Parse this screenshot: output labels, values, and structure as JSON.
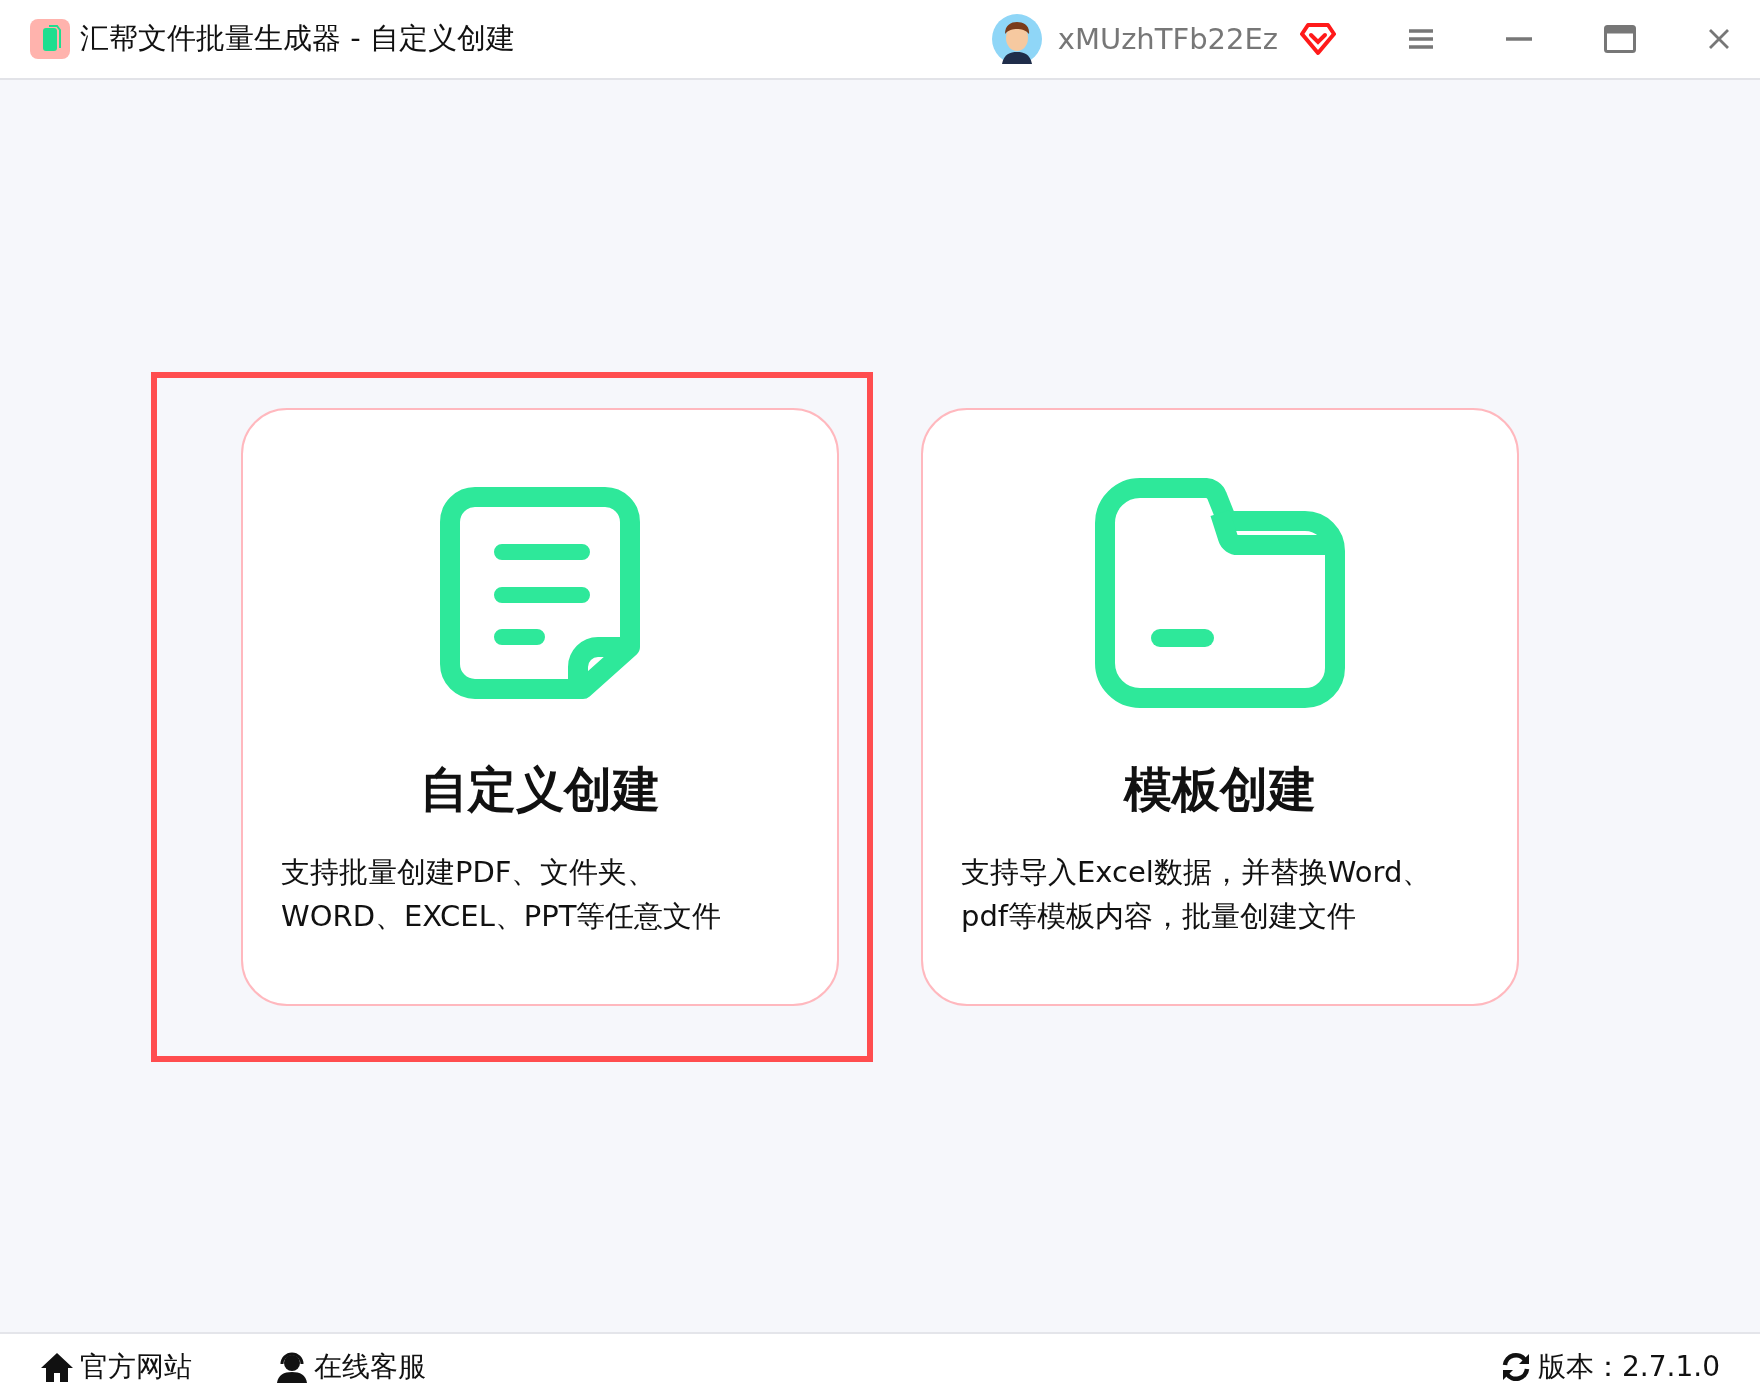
{
  "window": {
    "title": "汇帮文件批量生成器 - 自定义创建",
    "username": "xMUzhTFb22Ez"
  },
  "cards": [
    {
      "kind": "document",
      "title": "自定义创建",
      "description": "支持批量创建PDF、文件夹、\nWORD、EXCEL、PPT等任意文件",
      "highlighted": true
    },
    {
      "kind": "folder",
      "title": "模板创建",
      "description": "支持导入Excel数据，并替换Word、\npdf等模板内容，批量创建文件",
      "highlighted": false
    }
  ],
  "footer": {
    "links": [
      {
        "kind": "home",
        "label": "官方网站"
      },
      {
        "kind": "support",
        "label": "在线客服"
      }
    ],
    "version": {
      "kind": "refresh",
      "label": "版本：2.7.1.0"
    }
  }
}
